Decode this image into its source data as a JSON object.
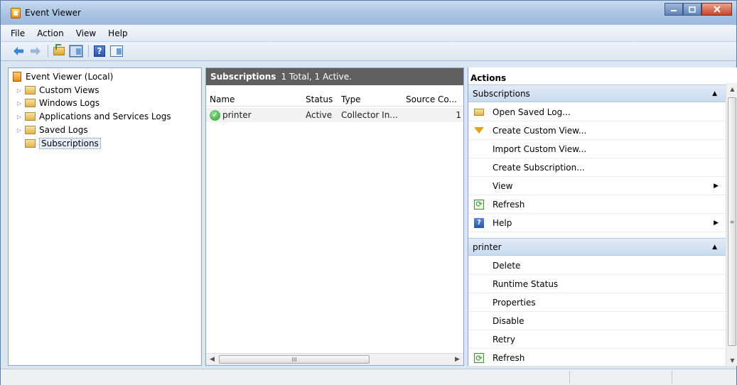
{
  "window": {
    "title": "Event Viewer"
  },
  "menu": [
    "File",
    "Action",
    "View",
    "Help"
  ],
  "toolbar": {
    "help_label": "?"
  },
  "tree": {
    "root": "Event Viewer (Local)",
    "items": [
      "Custom Views",
      "Windows Logs",
      "Applications and Services Logs",
      "Saved Logs",
      "Subscriptions"
    ],
    "selected": "Subscriptions"
  },
  "middle": {
    "header_title": "Subscriptions",
    "header_summary": "1 Total, 1 Active.",
    "columns": [
      "Name",
      "Status",
      "Type",
      "Source Co..."
    ],
    "rows": [
      {
        "name": "printer",
        "status": "Active",
        "type": "Collector In...",
        "source": "1"
      }
    ],
    "scroll_thumb": "III"
  },
  "actions": {
    "title": "Actions",
    "sections": [
      {
        "header": "Subscriptions",
        "items": [
          "Open Saved Log...",
          "Create Custom View...",
          "Import Custom View...",
          "Create Subscription...",
          "View",
          "Refresh",
          "Help"
        ]
      },
      {
        "header": "printer",
        "items": [
          "Delete",
          "Runtime Status",
          "Properties",
          "Disable",
          "Retry",
          "Refresh"
        ]
      }
    ],
    "scroll_thumb": "≡"
  },
  "colors": {
    "title_bar": "#a9c3e3",
    "section_header": "#c9dbf0",
    "middle_header": "#5f5f5f",
    "status_active": "#2f9a2f"
  },
  "icons": {
    "app": "event-viewer-icon",
    "nav_back": "arrow-left-icon",
    "nav_forward": "arrow-right-icon",
    "status_ok": "green-check-icon",
    "refresh": "refresh-icon",
    "help": "help-icon",
    "folder": "folder-icon",
    "filter": "filter-icon"
  }
}
